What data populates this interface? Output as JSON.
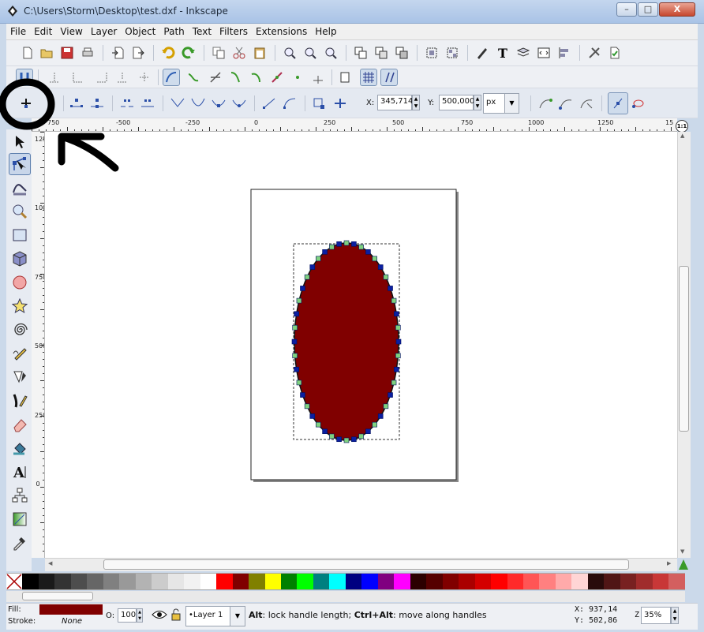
{
  "window": {
    "title": "C:\\Users\\Storm\\Desktop\\test.dxf - Inkscape",
    "minimize": "–",
    "maximize": "□",
    "close": "X"
  },
  "menu": [
    "File",
    "Edit",
    "View",
    "Layer",
    "Object",
    "Path",
    "Text",
    "Filters",
    "Extensions",
    "Help"
  ],
  "node_toolbar": {
    "x_label": "X:",
    "x_value": "345,714",
    "y_label": "Y:",
    "y_value": "500,000",
    "unit": "px"
  },
  "ruler": {
    "h_labels": [
      "750",
      "-500",
      "-250",
      "0",
      "250",
      "500",
      "750",
      "1000",
      "1250",
      "15"
    ],
    "v_labels": [
      "1250",
      "1000",
      "750",
      "500",
      "250",
      "0"
    ],
    "zoom_button": "1:1"
  },
  "palette": [
    "#ffffff",
    "#000000",
    "#1a1a1a",
    "#333333",
    "#4d4d4d",
    "#666666",
    "#808080",
    "#999999",
    "#b3b3b3",
    "#cccccc",
    "#e6e6e6",
    "#f2f2f2",
    "#ffffff",
    "#ff0000",
    "#800000",
    "#808000",
    "#ffff00",
    "#008000",
    "#00ff00",
    "#008080",
    "#00ffff",
    "#000080",
    "#0000ff",
    "#800080",
    "#ff00ff",
    "#2b0000",
    "#550000",
    "#800000",
    "#aa0000",
    "#d40000",
    "#ff0000",
    "#ff2a2a",
    "#ff5555",
    "#ff8080",
    "#ffaaaa",
    "#ffd5d5",
    "#280b0b",
    "#501616",
    "#782121",
    "#a02c2c",
    "#c83737",
    "#d35f5f"
  ],
  "status": {
    "fill_label": "Fill:",
    "fill_color": "#800000",
    "stroke_label": "Stroke:",
    "stroke_value": "None",
    "opacity_label": "O:",
    "opacity_value": "100",
    "layer": "•Layer 1",
    "message_bold1": "Alt",
    "message_1": ": lock handle length; ",
    "message_bold2": "Ctrl+Alt",
    "message_2": ": move along handles",
    "cursor_x_label": "X:",
    "cursor_x": "937,14",
    "cursor_y_label": "Y:",
    "cursor_y": "502,86",
    "zoom_label": "Z:",
    "zoom": "35%"
  },
  "colors": {
    "ellipse_fill": "#800000",
    "node": "#0b1fa0",
    "node_highlight": "#7fd17f",
    "annotation": "#000000"
  }
}
